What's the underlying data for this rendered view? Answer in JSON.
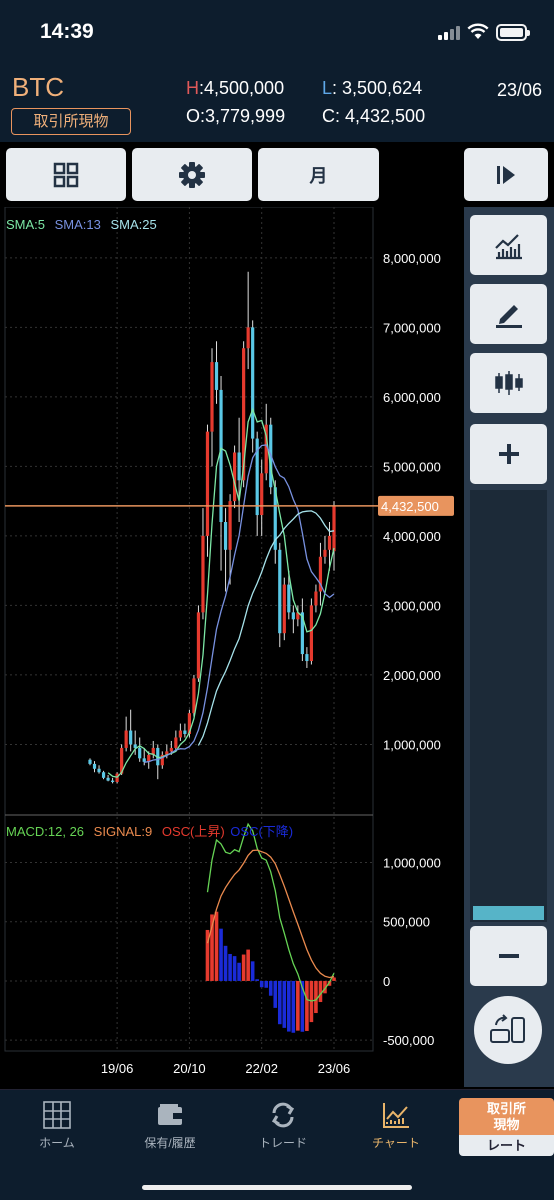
{
  "status_bar": {
    "time": "14:39"
  },
  "header": {
    "symbol": "BTC",
    "market_badge": "取引所現物",
    "high_key": "H",
    "high_value": ":4,500,000",
    "low_key": "L",
    "low_value": ": 3,500,624",
    "open_value": "O:3,779,999",
    "close_value": "C: 4,432,500",
    "date": "23/06"
  },
  "toolbar": {
    "grid_icon": "grid-icon",
    "settings_icon": "gear-icon",
    "period_label": "月"
  },
  "right_panel": {
    "icons": [
      "play-skip-icon",
      "chart-indicator-icon",
      "pen-draw-icon",
      "candlestick-icon",
      "plus-icon",
      "minus-icon",
      "rotate-device-icon"
    ]
  },
  "indicators": {
    "sma5": "SMA:5",
    "sma13": "SMA:13",
    "sma25": "SMA:25",
    "macd": "MACD:12, 26",
    "signal": "SIGNAL:9",
    "osc_up": "OSC(上昇)",
    "osc_down": "OSC(下降)"
  },
  "colors": {
    "up": "#e63a2e",
    "down": "#5ac8e6",
    "sma5": "#7de8a6",
    "sma13": "#7891e0",
    "sma25": "#a6e2ea",
    "macd": "#66d455",
    "signal": "#ea8a4e",
    "osc_up": "#e63a2e",
    "osc_down": "#1a2bd8",
    "current_price": "#e8945e"
  },
  "price_axis": {
    "labels": [
      "8,000,000",
      "7,000,000",
      "6,000,000",
      "5,000,000",
      "4,000,000",
      "3,000,000",
      "2,000,000",
      "1,000,000"
    ],
    "current_price_label": "4,432,500"
  },
  "macd_axis": {
    "labels": [
      "1,000,000",
      "500,000",
      "0",
      "-500,000"
    ]
  },
  "time_axis": {
    "labels": [
      "19/06",
      "20/10",
      "22/02",
      "23/06"
    ]
  },
  "chart_data": {
    "type": "candlestick",
    "title": "",
    "xlabel": "",
    "ylabel": "",
    "ylim": [
      0,
      8500000
    ],
    "current_price": 4432500,
    "x": [
      "2018/12",
      "2019/01",
      "2019/02",
      "2019/03",
      "2019/04",
      "2019/05",
      "2019/06",
      "2019/07",
      "2019/08",
      "2019/09",
      "2019/10",
      "2019/11",
      "2019/12",
      "2020/01",
      "2020/02",
      "2020/03",
      "2020/04",
      "2020/05",
      "2020/06",
      "2020/07",
      "2020/08",
      "2020/09",
      "2020/10",
      "2020/11",
      "2020/12",
      "2021/01",
      "2021/02",
      "2021/03",
      "2021/04",
      "2021/05",
      "2021/06",
      "2021/07",
      "2021/08",
      "2021/09",
      "2021/10",
      "2021/11",
      "2021/12",
      "2022/01",
      "2022/02",
      "2022/03",
      "2022/04",
      "2022/05",
      "2022/06",
      "2022/07",
      "2022/08",
      "2022/09",
      "2022/10",
      "2022/11",
      "2022/12",
      "2023/01",
      "2023/02",
      "2023/03",
      "2023/04",
      "2023/05",
      "2023/06"
    ],
    "ohlc": [
      [
        780000,
        800000,
        700000,
        720000
      ],
      [
        720000,
        760000,
        600000,
        650000
      ],
      [
        650000,
        700000,
        580000,
        600000
      ],
      [
        600000,
        620000,
        500000,
        520000
      ],
      [
        520000,
        560000,
        470000,
        480000
      ],
      [
        480000,
        520000,
        440000,
        460000
      ],
      [
        460000,
        600000,
        440000,
        580000
      ],
      [
        580000,
        1000000,
        560000,
        950000
      ],
      [
        950000,
        1400000,
        900000,
        1200000
      ],
      [
        1200000,
        1500000,
        900000,
        1000000
      ],
      [
        1000000,
        1200000,
        850000,
        950000
      ],
      [
        950000,
        1100000,
        750000,
        800000
      ],
      [
        800000,
        950000,
        700000,
        750000
      ],
      [
        750000,
        900000,
        650000,
        850000
      ],
      [
        850000,
        1050000,
        800000,
        950000
      ],
      [
        950000,
        1000000,
        500000,
        700000
      ],
      [
        700000,
        900000,
        650000,
        850000
      ],
      [
        850000,
        1000000,
        800000,
        900000
      ],
      [
        900000,
        1050000,
        850000,
        950000
      ],
      [
        950000,
        1200000,
        900000,
        1100000
      ],
      [
        1100000,
        1300000,
        1050000,
        1200000
      ],
      [
        1200000,
        1300000,
        1100000,
        1150000
      ],
      [
        1150000,
        1500000,
        1100000,
        1450000
      ],
      [
        1450000,
        2000000,
        1400000,
        1950000
      ],
      [
        1950000,
        3000000,
        1900000,
        2900000
      ],
      [
        2900000,
        4400000,
        2800000,
        4000000
      ],
      [
        4000000,
        5600000,
        3700000,
        5500000
      ],
      [
        5500000,
        6700000,
        5000000,
        6500000
      ],
      [
        6500000,
        6800000,
        5900000,
        6100000
      ],
      [
        6100000,
        6300000,
        3500000,
        4200000
      ],
      [
        4200000,
        4400000,
        3200000,
        3800000
      ],
      [
        3800000,
        4600000,
        3300000,
        4500000
      ],
      [
        4500000,
        5300000,
        4400000,
        5200000
      ],
      [
        5200000,
        5700000,
        4200000,
        4800000
      ],
      [
        4800000,
        6800000,
        4700000,
        6700000
      ],
      [
        6700000,
        7800000,
        6400000,
        7000000
      ],
      [
        7000000,
        7100000,
        5200000,
        5400000
      ],
      [
        5400000,
        5500000,
        4000000,
        4300000
      ],
      [
        4300000,
        5100000,
        4000000,
        4900000
      ],
      [
        4900000,
        5900000,
        4800000,
        5600000
      ],
      [
        5600000,
        5700000,
        4600000,
        4700000
      ],
      [
        4700000,
        4800000,
        3600000,
        3800000
      ],
      [
        3800000,
        3900000,
        2400000,
        2600000
      ],
      [
        2600000,
        3400000,
        2500000,
        3300000
      ],
      [
        3300000,
        3500000,
        2800000,
        2900000
      ],
      [
        2900000,
        3000000,
        2600000,
        2800000
      ],
      [
        2800000,
        3000000,
        2700000,
        2900000
      ],
      [
        2900000,
        3100000,
        2200000,
        2300000
      ],
      [
        2300000,
        2400000,
        2100000,
        2200000
      ],
      [
        2200000,
        3100000,
        2150000,
        3000000
      ],
      [
        3000000,
        3300000,
        2900000,
        3200000
      ],
      [
        3200000,
        3900000,
        3000000,
        3700000
      ],
      [
        3700000,
        4000000,
        3600000,
        3800000
      ],
      [
        3800000,
        4200000,
        3500000,
        4000000
      ],
      [
        3779999,
        4500000,
        3500624,
        4432500
      ]
    ],
    "series": [
      {
        "name": "SMA:5",
        "values": []
      },
      {
        "name": "SMA:13",
        "values": []
      },
      {
        "name": "SMA:25",
        "values": []
      }
    ],
    "macd_panel": {
      "ylim": [
        -600000,
        1300000
      ],
      "macd": [
        null,
        null,
        null,
        null,
        null,
        null,
        null,
        null,
        null,
        null,
        null,
        null,
        null,
        null,
        null,
        null,
        null,
        null,
        null,
        null,
        null,
        null,
        null,
        null,
        null,
        null,
        null,
        null,
        null,
        null,
        null,
        null,
        null,
        null,
        null,
        null,
        null,
        null,
        null,
        null,
        null,
        null,
        null,
        null,
        null,
        null,
        null,
        null,
        null,
        null,
        null,
        null,
        null,
        null,
        null
      ],
      "signal": [],
      "osc": []
    }
  }
}
